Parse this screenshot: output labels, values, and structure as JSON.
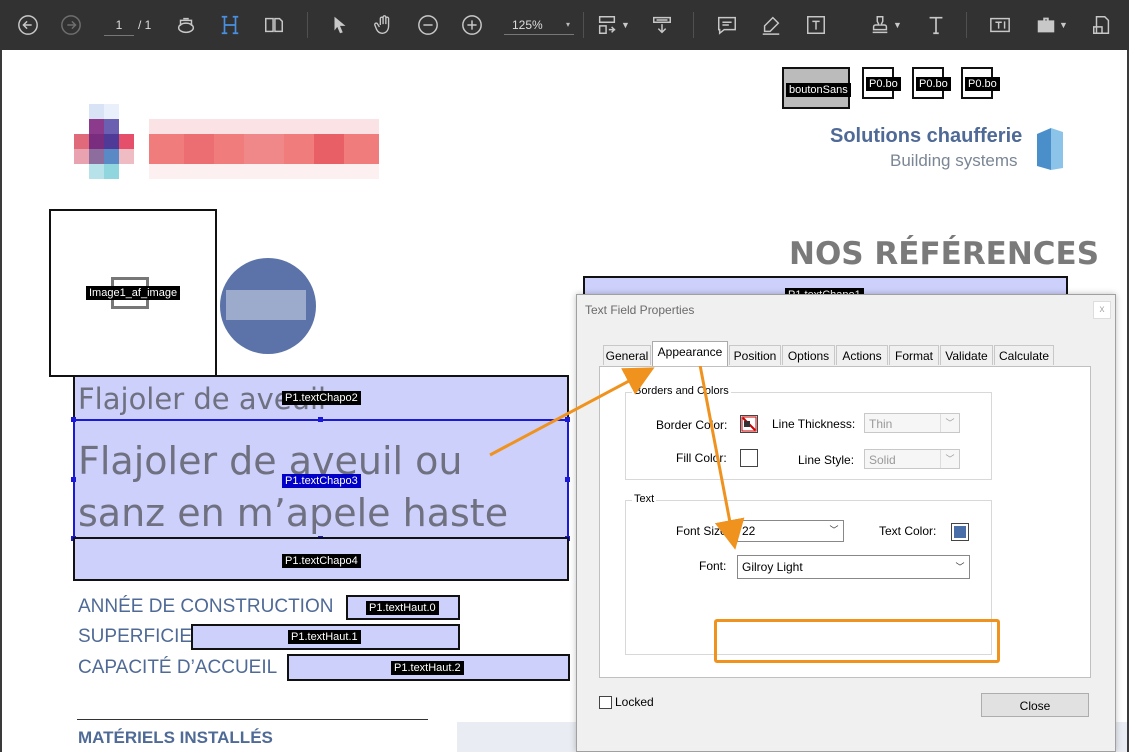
{
  "toolbar": {
    "page_current": "1",
    "page_total": "/ 1",
    "zoom": "125%",
    "zoom_caret": "▾"
  },
  "document": {
    "bouton_tag": "boutonSans",
    "p0_tags": [
      "P0.bo",
      "P0.bo",
      "P0.bo"
    ],
    "image_tag": "Image1_af_image",
    "brand_title": "Solutions chaufferie",
    "brand_subtitle": "Building systems",
    "heading_refs": "NOS RÉFÉRENCES",
    "chapo1_tag": "P1.textChapo1",
    "chapo2_text": "Flajoler de aveuil",
    "chapo2_tag": "P1.textChapo2",
    "chapo3_line1": "Flajoler de aveuil ou",
    "chapo3_line2": "sanz en m’apele haste",
    "chapo3_tag": "P1.textChapo3",
    "chapo4_tag": "P1.textChapo4",
    "annee_label": "ANNÉE DE CONSTRUCTION",
    "haut0_tag": "P1.textHaut.0",
    "superficie_label": "SUPERFICIE",
    "haut1_tag": "P1.textHaut.1",
    "capacite_label": "CAPACITÉ D’ACCUEIL",
    "haut2_tag": "P1.textHaut.2",
    "materiels_label": "MATÉRIELS INSTALLÉS"
  },
  "dialog": {
    "title": "Text Field Properties",
    "close_x": "x",
    "tabs": [
      "General",
      "Appearance",
      "Position",
      "Options",
      "Actions",
      "Format",
      "Validate",
      "Calculate"
    ],
    "active_tab": "Appearance",
    "borders_group": "Borders and Colors",
    "border_color_label": "Border Color:",
    "line_thickness_label": "Line Thickness:",
    "line_thickness_value": "Thin",
    "fill_color_label": "Fill Color:",
    "line_style_label": "Line Style:",
    "line_style_value": "Solid",
    "text_group": "Text",
    "font_size_label": "Font Size:",
    "font_size_value": "22",
    "text_color_label": "Text Color:",
    "font_label": "Font:",
    "font_value": "Gilroy Light",
    "locked_label": "Locked",
    "close_button": "Close"
  },
  "colors": {
    "toolbar_bg": "#323232",
    "field_fill": "#ccd0fb",
    "brand_blue": "#4f6a96",
    "annotation_orange": "#f0921e",
    "text_color_swatch": "#4a6ea8",
    "circle_blue": "#5b73a8"
  },
  "icons": [
    "back-icon",
    "forward-icon",
    "print-icon",
    "fit-height-icon",
    "two-page-icon",
    "select-arrow-icon",
    "hand-icon",
    "zoom-out-icon",
    "zoom-in-icon",
    "page-layout-icon",
    "scroll-icon",
    "comment-icon",
    "highlight-icon",
    "text-box-icon",
    "stamp-icon",
    "text-icon",
    "text-field-icon",
    "toolbox-icon",
    "document-tools-icon"
  ]
}
